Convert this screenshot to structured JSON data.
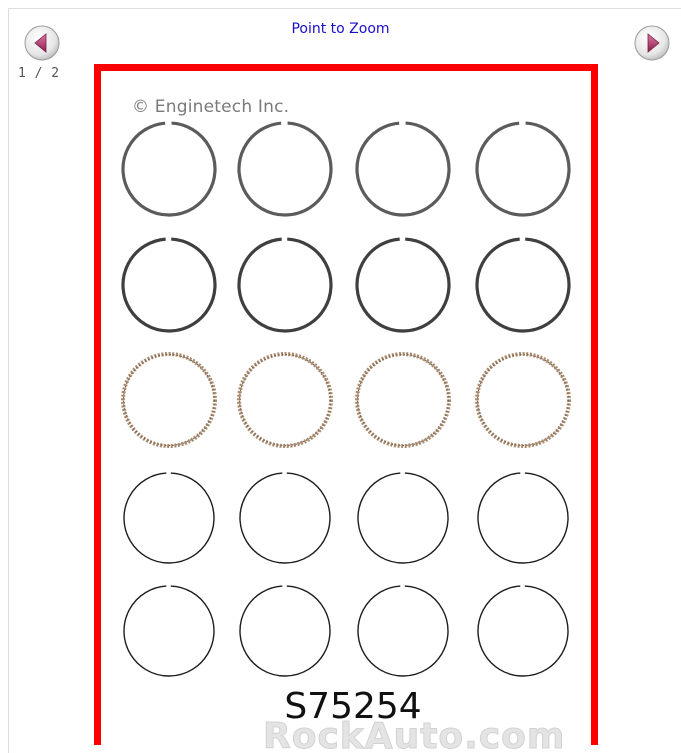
{
  "gallery": {
    "zoom_label": "Point to Zoom",
    "counter": "1 / 2",
    "prev_button": "prev-arrow-icon",
    "next_button": "next-arrow-icon",
    "accent_color": "#ff0000",
    "link_color": "#1a0dcc"
  },
  "product_image": {
    "copyright": "© Enginetech Inc.",
    "part_number": "S75254",
    "watermark": "RockAuto.com",
    "ring_rows": [
      {
        "style": "gray-compression",
        "count": 4
      },
      {
        "style": "dark-compression",
        "count": 4
      },
      {
        "style": "oil-expander",
        "count": 4
      },
      {
        "style": "thin-rail",
        "count": 4
      },
      {
        "style": "thin-rail",
        "count": 4
      }
    ]
  }
}
